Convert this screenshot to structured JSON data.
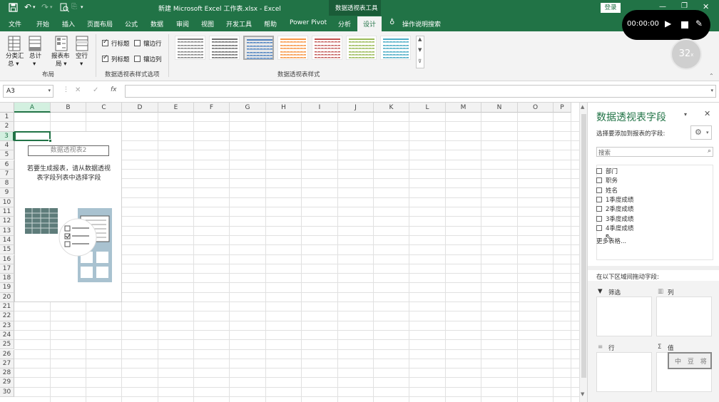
{
  "app": {
    "file_title": "新建 Microsoft Excel 工作表.xlsx  -  Excel",
    "context_tab": "数据透视表工具",
    "login": "登录"
  },
  "recorder": {
    "time": "00:00:00",
    "zoom": "32"
  },
  "ribbon_tabs": [
    "文件",
    "开始",
    "插入",
    "页面布局",
    "公式",
    "数据",
    "审阅",
    "视图",
    "开发工具",
    "帮助",
    "Power Pivot",
    "分析",
    "设计"
  ],
  "active_tab": "设计",
  "tell_me": "操作说明搜索",
  "layout_group": {
    "label": "布局",
    "buttons": [
      {
        "label1": "分类汇",
        "label2": "总 ▾"
      },
      {
        "label1": "总计",
        "label2": "▾"
      },
      {
        "label1": "报表布",
        "label2": "局 ▾"
      },
      {
        "label1": "空行",
        "label2": "▾"
      }
    ]
  },
  "options_group": {
    "label": "数据透视表样式选项",
    "checks": [
      {
        "label": "行标题",
        "checked": true
      },
      {
        "label": "镶边行",
        "checked": false
      },
      {
        "label": "列标题",
        "checked": true
      },
      {
        "label": "镶边列",
        "checked": false
      }
    ]
  },
  "styles_group": {
    "label": "数据透视表样式"
  },
  "formula_bar": {
    "name_box": "A3",
    "cancel": "✕",
    "enter": "✓",
    "fx": "fx"
  },
  "columns": [
    "A",
    "B",
    "C",
    "D",
    "E",
    "F",
    "G",
    "H",
    "I",
    "J",
    "K",
    "L",
    "M",
    "N",
    "O",
    "P"
  ],
  "rows": [
    "1",
    "2",
    "3",
    "4",
    "5",
    "6",
    "7",
    "8",
    "9",
    "10",
    "11",
    "12",
    "13",
    "14",
    "15",
    "16",
    "17",
    "18",
    "19",
    "20",
    "21",
    "22",
    "23",
    "24",
    "25",
    "26",
    "27",
    "28",
    "29",
    "30"
  ],
  "pivot_placeholder": {
    "name": "数据透视表2",
    "hint1": "若要生成报表，请从数据透视",
    "hint2": "表字段列表中选择字段"
  },
  "pane": {
    "title": "数据透视表字段",
    "subtitle": "选择要添加到报表的字段:",
    "search_placeholder": "搜索",
    "fields": [
      "部门",
      "职务",
      "姓名",
      "1季度成绩",
      "2季度成绩",
      "3季度成绩",
      "4季度成绩"
    ],
    "more_tables": "更多表格...",
    "drag_hint": "在以下区域间拖动字段:",
    "areas": {
      "filter": "筛选",
      "columns": "列",
      "rows": "行",
      "values": "值"
    },
    "stamp": "中 豆 将"
  }
}
